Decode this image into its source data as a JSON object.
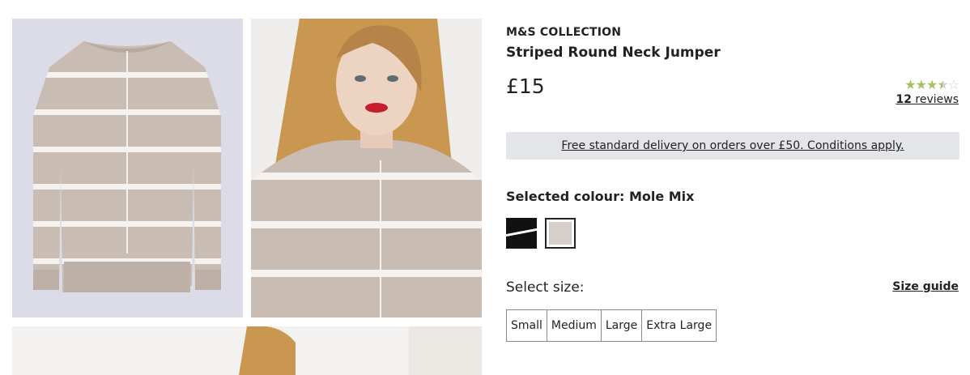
{
  "product": {
    "brand": "M&S COLLECTION",
    "title": "Striped Round Neck Jumper",
    "price": "£15"
  },
  "rating": {
    "value": 3.5,
    "max": 5,
    "count": "12",
    "reviews_word": "reviews"
  },
  "delivery": {
    "text": "Free standard delivery on orders over £50. Conditions apply."
  },
  "colour": {
    "label": "Selected colour:",
    "selected": "Mole Mix",
    "swatches": [
      {
        "name": "Black",
        "color": "#111111"
      },
      {
        "name": "Mole Mix",
        "color": "#d6cec7",
        "selected": true
      }
    ]
  },
  "size": {
    "label": "Select size:",
    "guide": "Size guide",
    "options": [
      "Small",
      "Medium",
      "Large",
      "Extra Large"
    ]
  },
  "colors": {
    "star_filled": "#a5c25c",
    "star_empty": "#cfcfcf",
    "banner_bg": "#e3e5e8",
    "jumper": "#c9bcb2"
  }
}
